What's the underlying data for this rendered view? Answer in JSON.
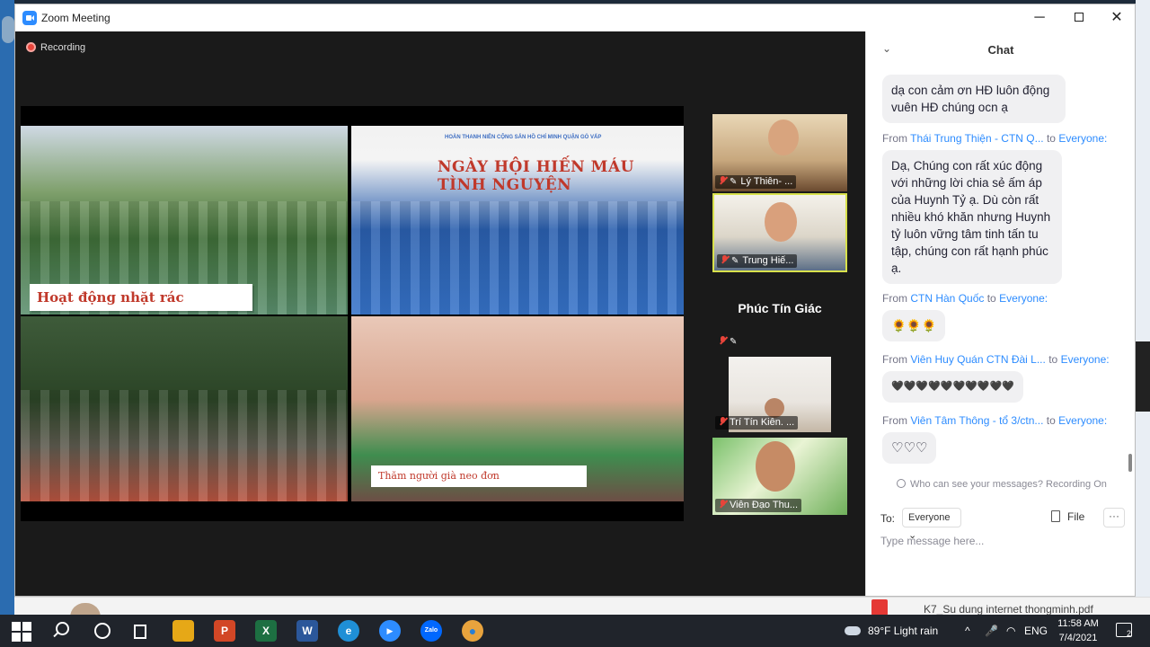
{
  "window": {
    "title": "Zoom Meeting",
    "minimize": "─",
    "close": "✕"
  },
  "meeting": {
    "recording_label": "Recording",
    "share": {
      "caption_top_left": "Hoạt động nhặt rác",
      "caption_bottom_right": "Thăm người già neo đơn",
      "poster_title": "NGÀY HỘI HIẾN MÁU TÌNH NGUYỆN",
      "poster_subtitle": "HOÀN THANH NIÊN CỘNG SẢN HỒ CHÍ MINH QUẬN GÒ VẤP"
    },
    "participants": [
      {
        "name": "Lý Thiên- ..."
      },
      {
        "name": "Trung Hiế..."
      },
      {
        "name": "Phúc Tín Giác"
      },
      {
        "name": "Trí Tín Kiên. ..."
      },
      {
        "name": "Viên Đạo Thu..."
      }
    ]
  },
  "chat": {
    "title": "Chat",
    "messages": [
      {
        "text": "dạ con cảm ơn HĐ luôn động vuên HĐ chúng ocn ạ"
      },
      {
        "from_prefix": "From",
        "sender": "Thái Trung Thiện - CTN Q...",
        "to_word": "to",
        "recipient": "Everyone:",
        "text": "Dạ, Chúng con rất xúc động với những lời chia sẻ ấm áp của Huynh Tỷ ạ. Dù còn rất nhiều khó khăn nhưng Huynh tỷ luôn vững tâm tinh tấn tu tập, chúng con rất hạnh phúc ạ."
      },
      {
        "from_prefix": "From",
        "sender": "CTN Hàn Quốc",
        "to_word": "to",
        "recipient": "Everyone:",
        "text": "🌻🌻🌻"
      },
      {
        "from_prefix": "From",
        "sender": "Viên Huy Quán CTN Đài L...",
        "to_word": "to",
        "recipient": "Everyone:",
        "text": "🖤🖤🖤🖤🖤🖤🖤🖤🖤🖤"
      },
      {
        "from_prefix": "From",
        "sender": "Viên Tâm Thông - tổ 3/ctn...",
        "to_word": "to",
        "recipient": "Everyone:",
        "text": "♡♡♡"
      }
    ],
    "privacy_notice": "Who can see your messages? Recording On",
    "to_label": "To:",
    "to_value": "Everyone",
    "file_label": "File",
    "more_label": "···",
    "input_placeholder": "Type message here..."
  },
  "background": {
    "doc_name": "K7_Su dung internet thongminh.pdf"
  },
  "taskbar": {
    "apps": [
      {
        "name": "powerpoint",
        "glyph": "P",
        "color": "#d24726"
      },
      {
        "name": "excel",
        "glyph": "X",
        "color": "#1d6f42"
      },
      {
        "name": "word",
        "glyph": "W",
        "color": "#2b579a"
      },
      {
        "name": "edge",
        "glyph": "e",
        "color": "#1f8fd6"
      },
      {
        "name": "zoom",
        "glyph": "▶",
        "color": "#2d8cff"
      },
      {
        "name": "zalo",
        "glyph": "Zalo",
        "color": "#0068ff"
      },
      {
        "name": "chrome",
        "glyph": "●",
        "color": "#e8a33d"
      }
    ],
    "weather": "89°F  Light rain",
    "up_arrow": "^",
    "language": "ENG",
    "time": "11:58 AM",
    "date": "7/4/2021",
    "notification_count": "2"
  }
}
